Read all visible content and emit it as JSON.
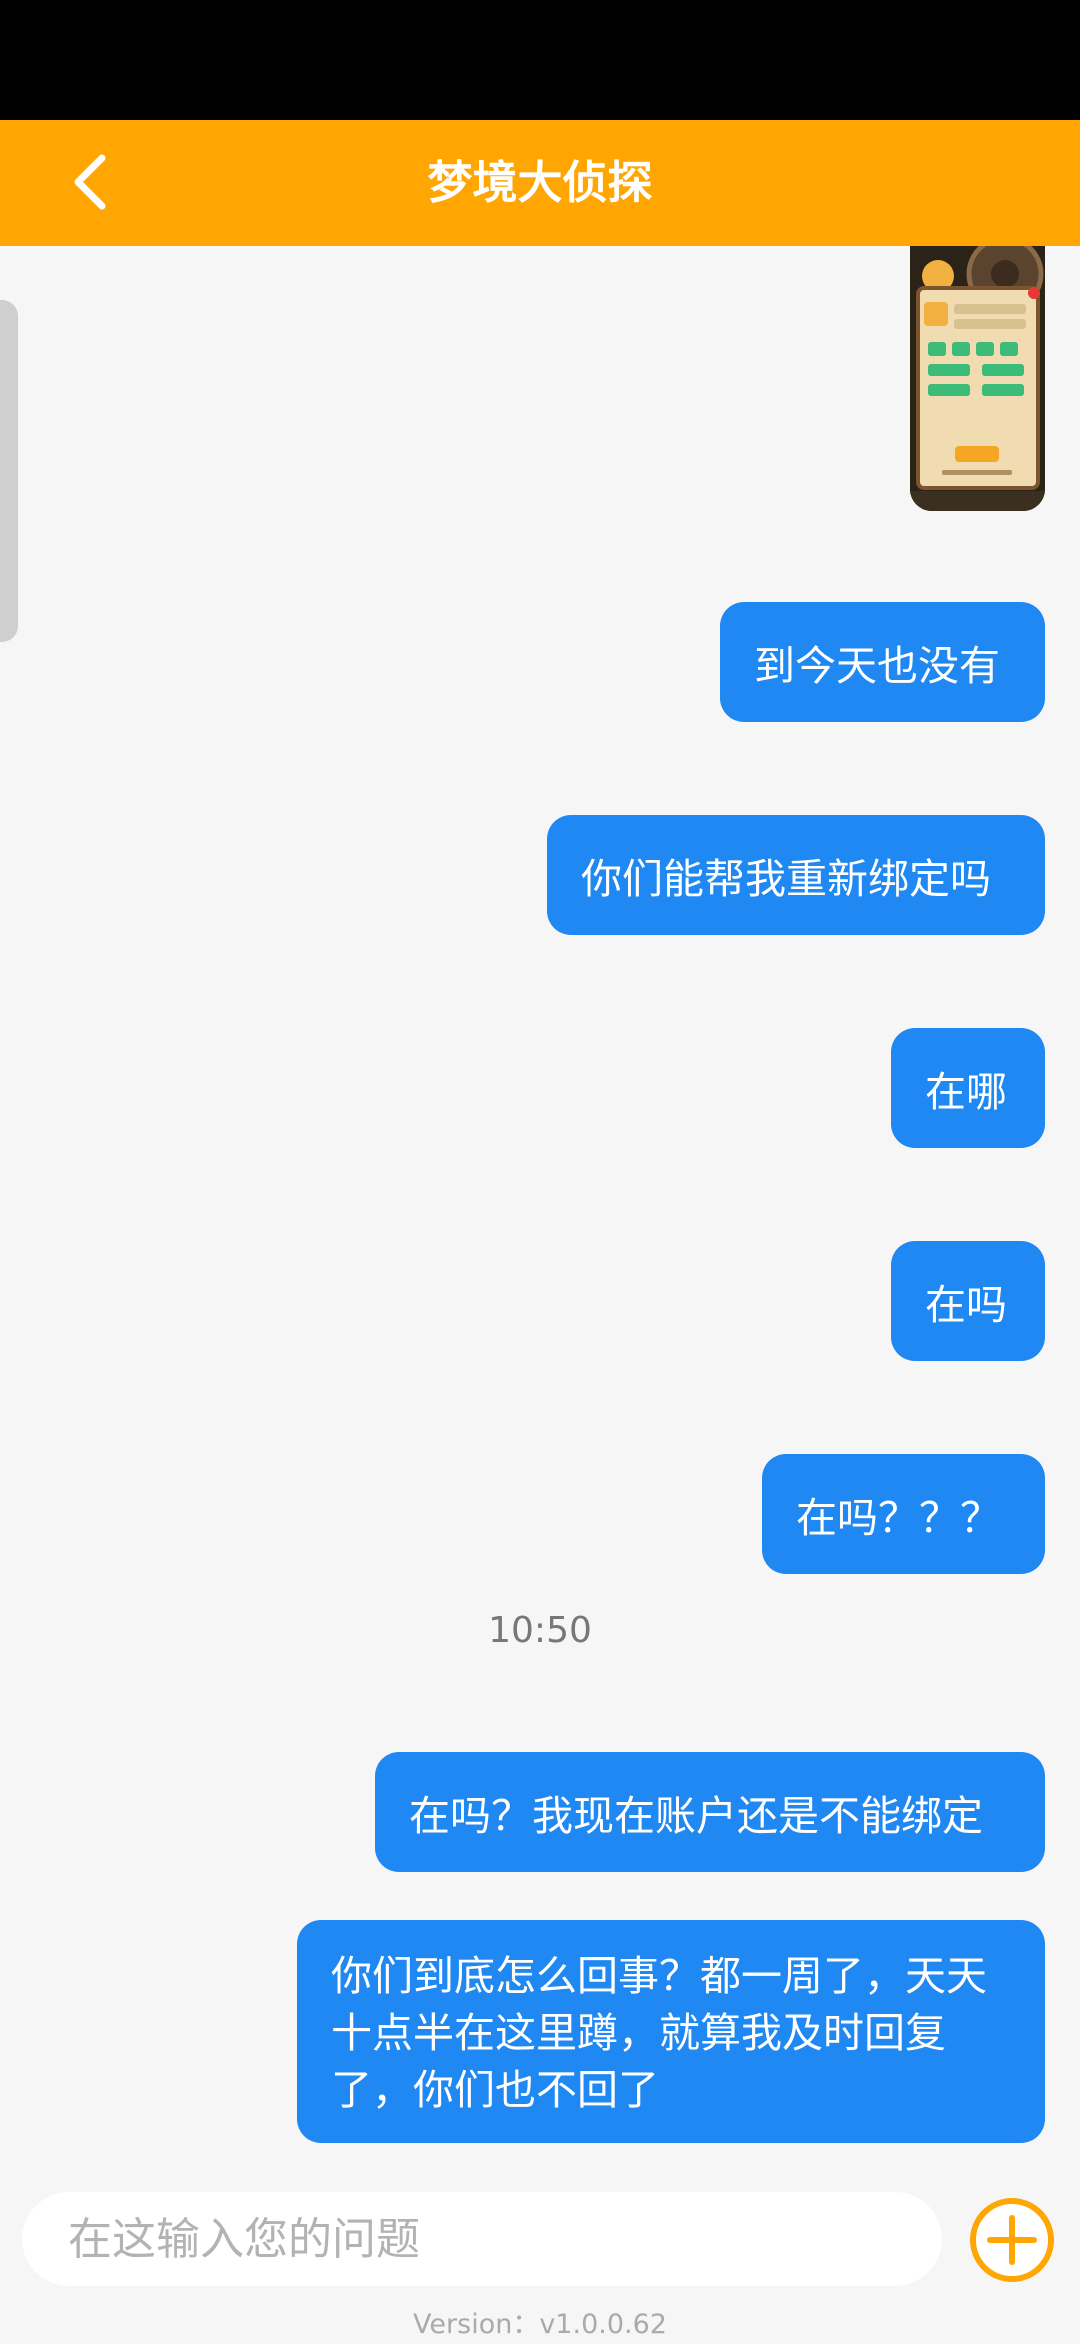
{
  "header": {
    "title": "梦境大侦探",
    "back_icon": "chevron-left-icon",
    "background": "#ffa602"
  },
  "messages": [
    {
      "type": "image",
      "alt": "game screenshot"
    },
    {
      "type": "text",
      "text": "到今天也没有"
    },
    {
      "type": "text",
      "text": "你们能帮我重新绑定吗"
    },
    {
      "type": "text",
      "text": "在哪"
    },
    {
      "type": "text",
      "text": "在吗"
    },
    {
      "type": "text",
      "text": "在吗？？？"
    },
    {
      "type": "text",
      "text": "在吗？我现在账户还是不能绑定"
    },
    {
      "type": "text",
      "text": "你们到底怎么回事？都一周了，天天十点半在这里蹲，就算我及时回复了，你们也不回了"
    }
  ],
  "timestamp": "10:50",
  "composer": {
    "placeholder": "在这输入您的问题",
    "value": "",
    "add_icon": "plus-circle-icon"
  },
  "footer": {
    "version": "Version：v1.0.0.62"
  },
  "colors": {
    "bubble": "#1f88f2",
    "accent": "#ffa602",
    "page_background": "#f6f6f6"
  }
}
